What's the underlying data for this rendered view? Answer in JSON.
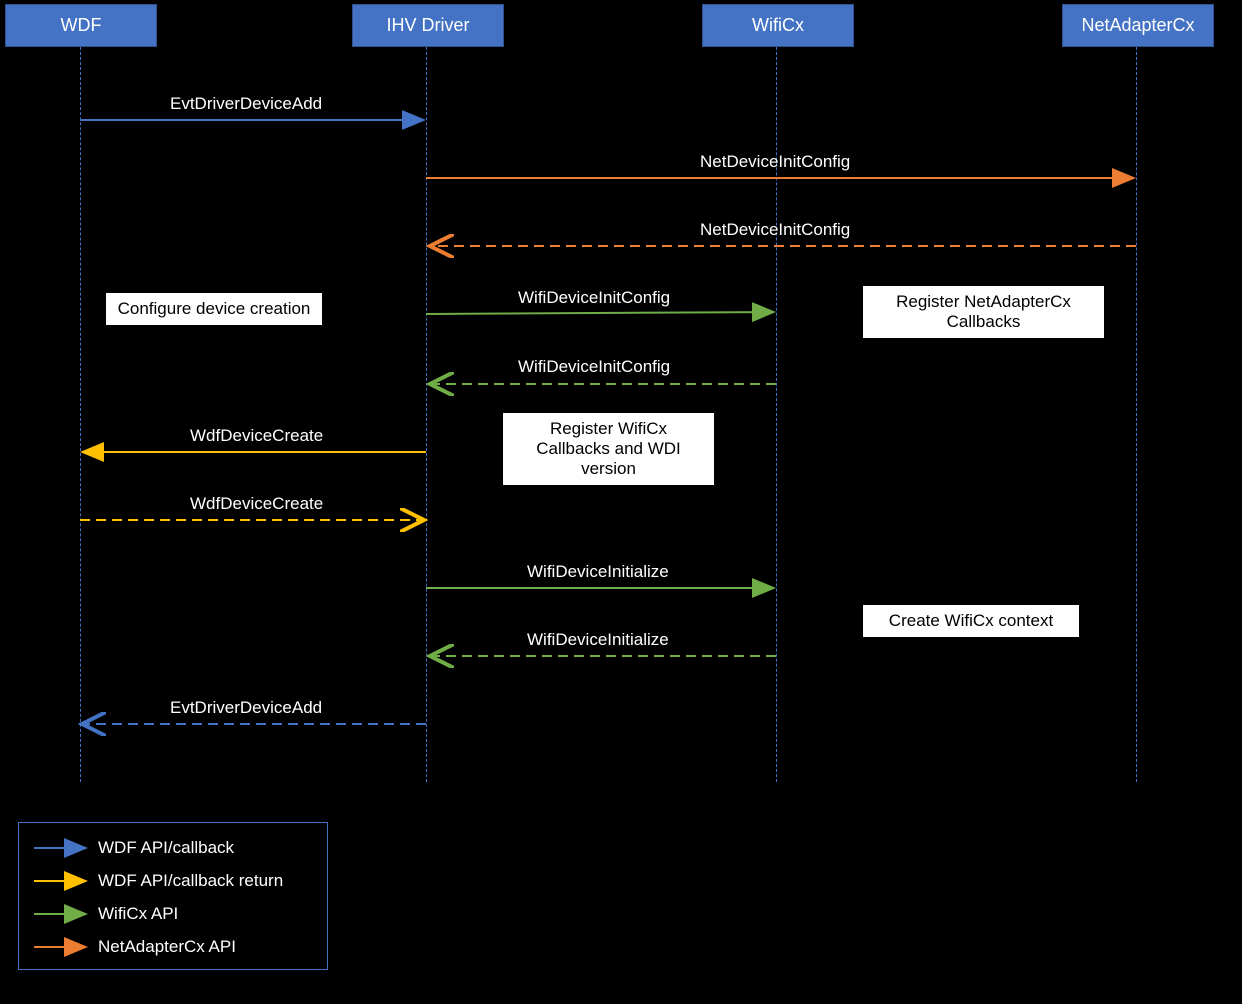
{
  "lifelines": {
    "wdf": "WDF",
    "ihv": "IHV Driver",
    "wificx": "WifiCx",
    "netadapter": "NetAdapterCx"
  },
  "labels": {
    "evtDriverDeviceAdd": "EvtDriverDeviceAdd",
    "netDeviceInitConfig": "NetDeviceInitConfig",
    "netDeviceInitConfigReturn": "NetDeviceInitConfig",
    "wifiDeviceInitConfig": "WifiDeviceInitConfig",
    "wifiDeviceInitConfigReturn": "WifiDeviceInitConfig",
    "wdfDeviceCreate": "WdfDeviceCreate",
    "wdfDeviceCreateReturn": "WdfDeviceCreate",
    "wifiDeviceInitialize": "WifiDeviceInitialize",
    "wifiDeviceInitializeReturn": "WifiDeviceInitialize",
    "evtDriverDeviceAddReturn": "EvtDriverDeviceAdd"
  },
  "notes": {
    "configureDevice": "Configure device creation",
    "registerNetAdapter": "Register NetAdapterCx Callbacks",
    "registerWificx": "Register WifiCx Callbacks and WDI version",
    "createWificx": "Create WifiCx context"
  },
  "legend": {
    "wdf": "WDF API/callback",
    "wdfReturn": "WDF API/callback return",
    "wificx": "WifiCx API",
    "netadapter": "NetAdapterCx API"
  }
}
